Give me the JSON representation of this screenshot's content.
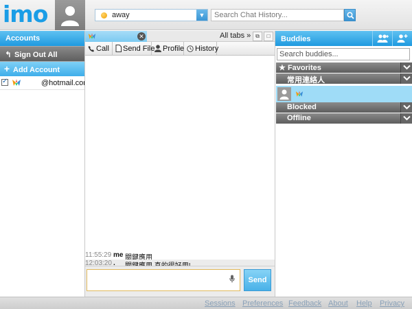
{
  "app": {
    "logo": "imo"
  },
  "header": {
    "status": {
      "value": "away"
    },
    "search": {
      "placeholder": "Search Chat History..."
    }
  },
  "sidebar": {
    "accounts_label": "Accounts",
    "sign_out_label": "Sign Out All",
    "add_account_label": "Add Account",
    "accounts": [
      {
        "address": "@hotmail.com",
        "checked": true
      }
    ]
  },
  "chat": {
    "all_tabs_label": "All tabs »",
    "actions": {
      "call": "Call",
      "send_file": "Send File",
      "profile": "Profile",
      "history": "History"
    },
    "messages": [
      {
        "time": "11:55:29",
        "sender": "me",
        "text": "關鍵應用"
      },
      {
        "time": "12:03:20",
        "sender": ".",
        "text": "關鍵應用 真的很好用!"
      }
    ],
    "input": {
      "value": "",
      "placeholder": ""
    },
    "send_label": "Send"
  },
  "buddies": {
    "title": "Buddies",
    "search": {
      "placeholder": "Search buddies..."
    },
    "groups": {
      "favorites": "Favorites",
      "common": "常用連絡人",
      "blocked": "Blocked",
      "offline": "Offline"
    }
  },
  "footer": {
    "links": [
      "Sessions",
      "Preferences",
      "Feedback",
      "About",
      "Help",
      "Privacy"
    ]
  },
  "colors": {
    "accent": "#1f9ae0",
    "header_dark": "#5e5e5e",
    "selected_row": "#9fdcf7",
    "status_away": "#f0a000"
  }
}
